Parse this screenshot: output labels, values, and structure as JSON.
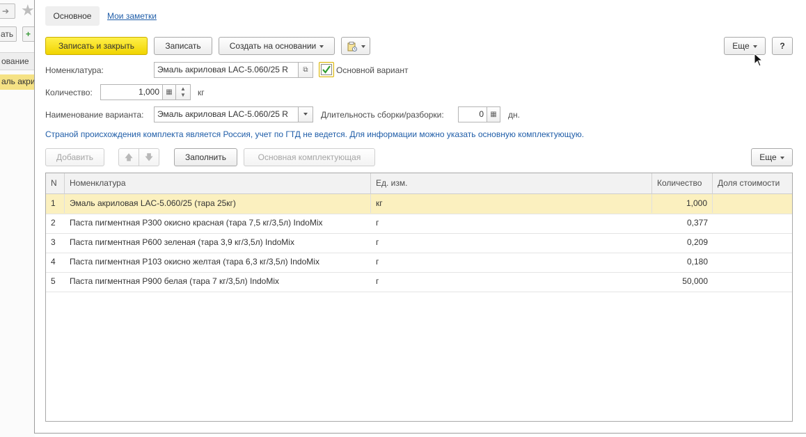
{
  "background_window": {
    "row_header": "ование",
    "selected_row": "аль акри",
    "button_label": "ать"
  },
  "tabs": [
    {
      "label": "Основное",
      "active": true
    },
    {
      "label": "Мои заметки",
      "active": false
    }
  ],
  "toolbar": {
    "save_close": "Записать и закрыть",
    "save": "Записать",
    "create_based_on": "Создать на основании",
    "more": "Еще",
    "help": "?"
  },
  "form": {
    "nomenclature_label": "Номенклатура:",
    "nomenclature_value": "Эмаль акриловая LAC-5.060/25 R",
    "main_variant_label": "Основной вариант",
    "main_variant_checked": true,
    "quantity_label": "Количество:",
    "quantity_value": "1,000",
    "quantity_unit": "кг",
    "variant_name_label": "Наименование варианта:",
    "variant_name_value": "Эмаль акриловая LAC-5.060/25 R",
    "duration_label": "Длительность сборки/разборки:",
    "duration_value": "0",
    "duration_unit": "дн.",
    "info_text": "Страной происхождения комплекта является Россия, учет по ГТД не ведется. Для информации можно указать основную комплектующую."
  },
  "table_toolbar": {
    "add": "Добавить",
    "fill": "Заполнить",
    "main_component": "Основная комплектующая",
    "more": "Еще"
  },
  "table": {
    "columns": [
      "N",
      "Номенклатура",
      "Ед. изм.",
      "Количество",
      "Доля стоимости"
    ],
    "rows": [
      {
        "n": "1",
        "name": "Эмаль акриловая LAC-5.060/25 (тара 25кг)",
        "unit": "кг",
        "qty": "1,000",
        "share": ""
      },
      {
        "n": "2",
        "name": "Паста пигментная P300 окисно красная (тара 7,5 кг/3,5л) IndoMix",
        "unit": "г",
        "qty": "0,377",
        "share": ""
      },
      {
        "n": "3",
        "name": "Паста пигментная P600 зеленая (тара 3,9 кг/3,5л) IndoMix",
        "unit": "г",
        "qty": "0,209",
        "share": ""
      },
      {
        "n": "4",
        "name": "Паста пигментная P103 окисно желтая (тара 6,3 кг/3,5л) IndoMix",
        "unit": "г",
        "qty": "0,180",
        "share": ""
      },
      {
        "n": "5",
        "name": "Паста пигментная P900 белая (тара 7 кг/3,5л) IndoMix",
        "unit": "г",
        "qty": "50,000",
        "share": ""
      }
    ],
    "selected_row": 0
  },
  "colors": {
    "primary_button": "#f5dc15",
    "selected_row": "#fbf0bf",
    "link": "#1f5da8",
    "checkbox": "#2f9e2f"
  }
}
